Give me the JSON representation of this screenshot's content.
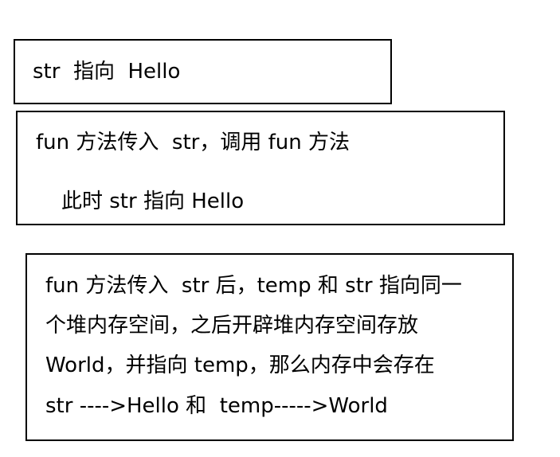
{
  "boxes": [
    {
      "lines": [
        "str  指向  Hello"
      ]
    },
    {
      "lines": [
        "fun 方法传入  str，调用 fun 方法",
        "此时 str 指向 Hello"
      ]
    },
    {
      "lines": [
        "fun 方法传入  str 后，temp 和 str 指向同一",
        "个堆内存空间，之后开辟堆内存空间存放",
        "World，并指向 temp，那么内存中会存在",
        "str ---->Hello 和  temp----->World"
      ]
    }
  ]
}
